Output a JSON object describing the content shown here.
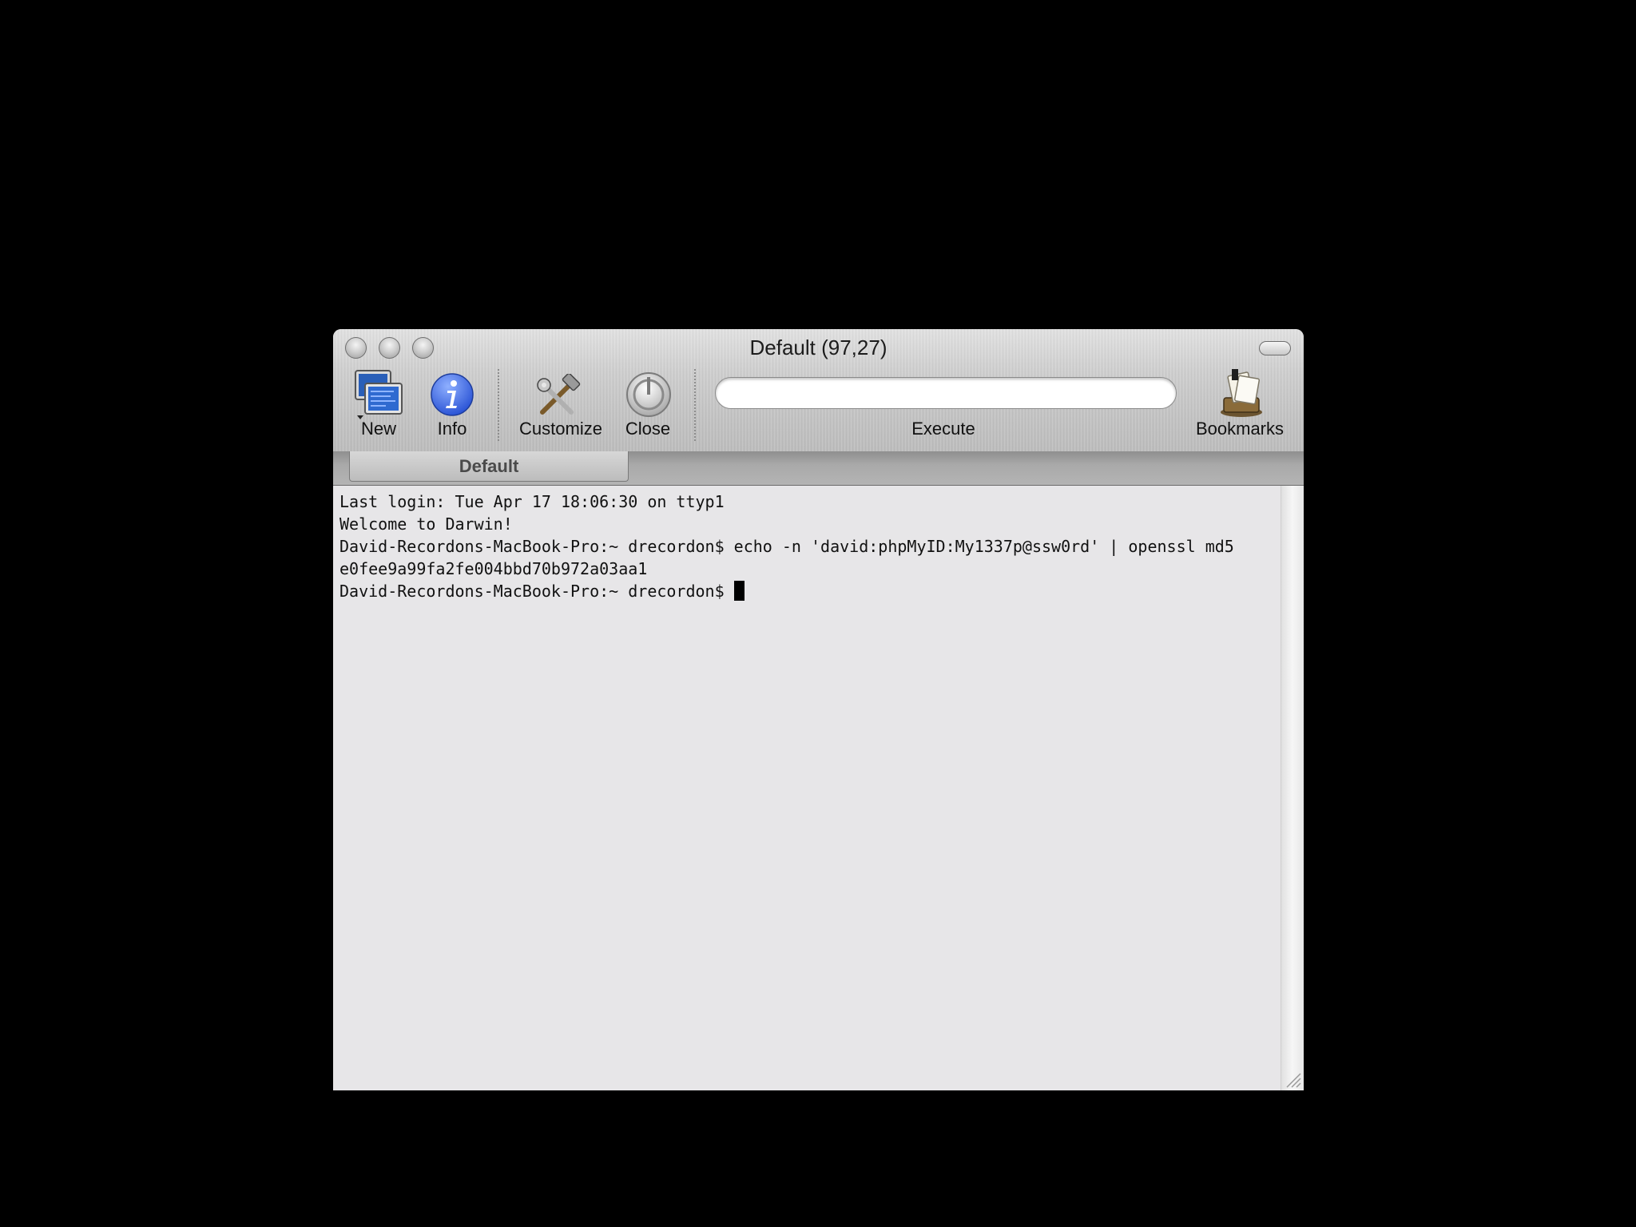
{
  "window": {
    "title": "Default (97,27)"
  },
  "toolbar": {
    "new_label": "New",
    "info_label": "Info",
    "customize_label": "Customize",
    "close_label": "Close",
    "execute_label": "Execute",
    "execute_value": "",
    "bookmarks_label": "Bookmarks"
  },
  "tabs": [
    {
      "label": "Default"
    }
  ],
  "terminal": {
    "lines": [
      "Last login: Tue Apr 17 18:06:30 on ttyp1",
      "Welcome to Darwin!",
      "David-Recordons-MacBook-Pro:~ drecordon$ echo -n 'david:phpMyID:My1337p@ssw0rd' | openssl md5",
      "e0fee9a99fa2fe004bbd70b972a03aa1"
    ],
    "prompt": "David-Recordons-MacBook-Pro:~ drecordon$ "
  },
  "icons": {
    "new": "new-terminal-icon",
    "info": "info-icon",
    "customize": "tools-icon",
    "close": "close-icon",
    "bookmarks": "bookmarks-icon"
  }
}
